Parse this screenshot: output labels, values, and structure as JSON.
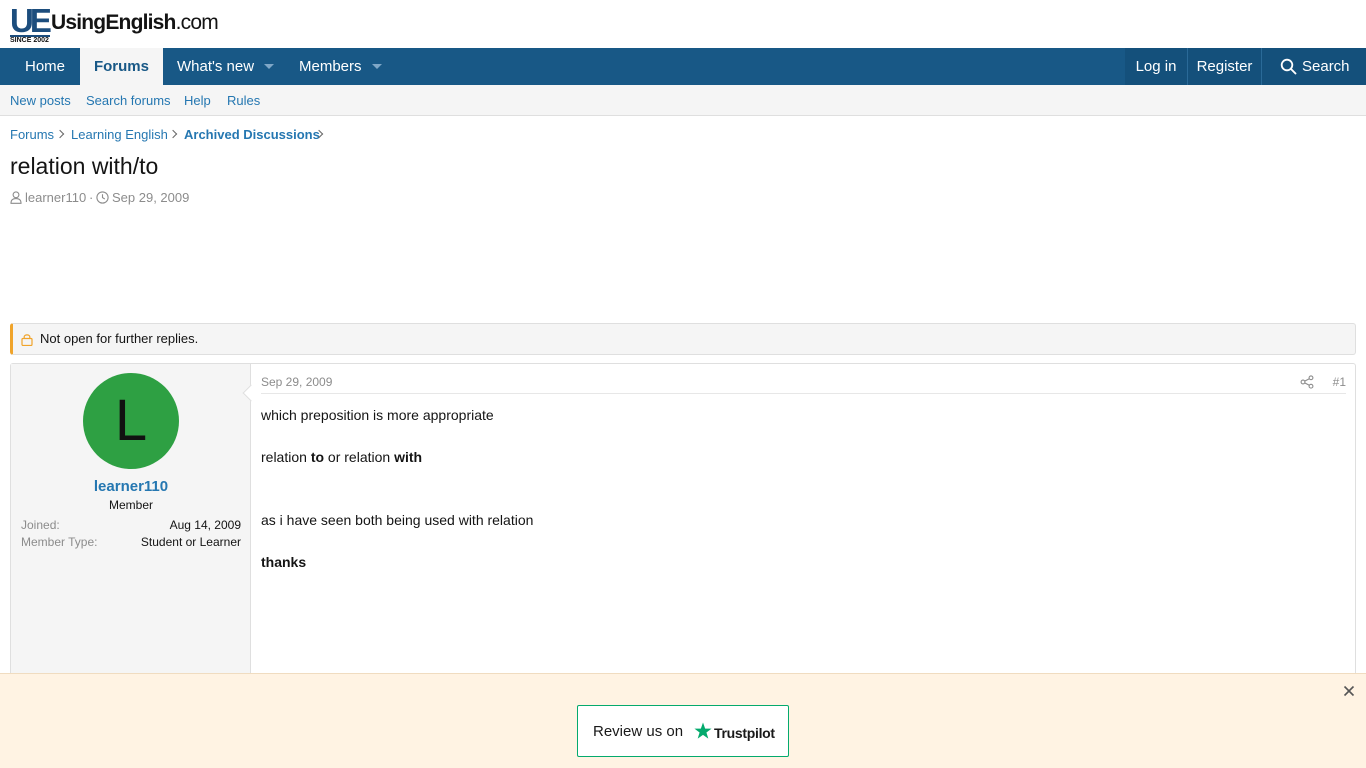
{
  "logo": {
    "mark": "UE",
    "since": "SINCE 2002",
    "name": "UsingEnglish",
    "tld": ".com"
  },
  "nav": {
    "home": "Home",
    "forums": "Forums",
    "whats_new": "What's new",
    "members": "Members",
    "login": "Log in",
    "register": "Register",
    "search": "Search"
  },
  "subnav": {
    "new_posts": "New posts",
    "search_forums": "Search forums",
    "help": "Help",
    "rules": "Rules"
  },
  "breadcrumb": [
    "Forums",
    "Learning English",
    "Archived Discussions"
  ],
  "thread": {
    "title": "relation with/to",
    "author": "learner110",
    "date": "Sep 29, 2009"
  },
  "notice": "Not open for further replies.",
  "post": {
    "user": {
      "avatar_letter": "L",
      "avatar_color": "#2ea043",
      "name": "learner110",
      "title": "Member",
      "joined_label": "Joined:",
      "joined_value": "Aug 14, 2009",
      "type_label": "Member Type:",
      "type_value": "Student or Learner"
    },
    "date": "Sep 29, 2009",
    "number": "#1",
    "line1": "which preposition is more appropriate",
    "line2": {
      "a": "relation ",
      "b": "to",
      "c": " or relation ",
      "d": "with"
    },
    "line3": "as i have seen both being used with relation",
    "line4": "thanks"
  },
  "banner": {
    "review_text": "Review us on",
    "brand": "Trustpilot"
  }
}
